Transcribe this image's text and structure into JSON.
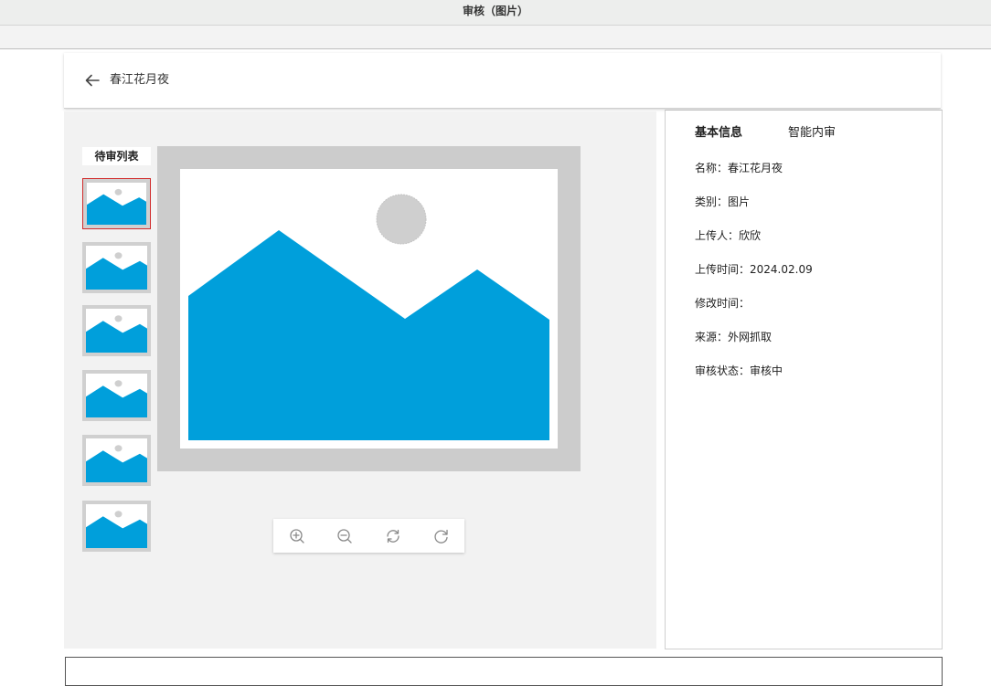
{
  "window": {
    "title": "审核（图片）"
  },
  "header": {
    "back_icon": "arrow-left-icon",
    "title": "春江花月夜"
  },
  "viewer": {
    "list_label": "待审列表",
    "thumbnails": [
      {
        "icon": "image-placeholder-icon",
        "selected": true
      },
      {
        "icon": "image-placeholder-icon",
        "selected": false
      },
      {
        "icon": "image-placeholder-icon",
        "selected": false
      },
      {
        "icon": "image-placeholder-icon",
        "selected": false
      },
      {
        "icon": "image-placeholder-icon",
        "selected": false
      },
      {
        "icon": "image-placeholder-icon",
        "selected": false
      }
    ],
    "preview_icon": "image-placeholder-icon",
    "controls": [
      "zoom-in-icon",
      "zoom-out-icon",
      "rotate-icon",
      "refresh-icon"
    ]
  },
  "info": {
    "tabs": {
      "basic": "基本信息",
      "smart": "智能内审"
    },
    "rows": {
      "name": "名称：春江花月夜",
      "category": "类别：图片",
      "uploader": "上传人：欣欣",
      "upload_time": "上传时间：2024.02.09",
      "modify_time": "修改时间：",
      "source": "来源：外网抓取",
      "status": "审核状态：审核中"
    }
  },
  "colors": {
    "accent": "#009fdb",
    "selected_border": "#d12a2a",
    "sun": "#cfcfcf"
  }
}
